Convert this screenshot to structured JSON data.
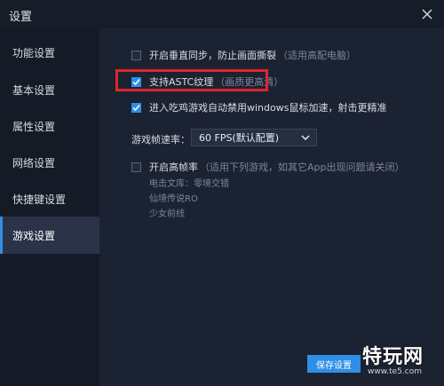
{
  "window": {
    "title": "设置"
  },
  "sidebar": {
    "items": [
      {
        "label": "功能设置",
        "active": false
      },
      {
        "label": "基本设置",
        "active": false
      },
      {
        "label": "属性设置",
        "active": false
      },
      {
        "label": "网络设置",
        "active": false
      },
      {
        "label": "快捷键设置",
        "active": false
      },
      {
        "label": "游戏设置",
        "active": true
      }
    ]
  },
  "options": {
    "vsync": {
      "label": "开启垂直同步，防止画面撕裂",
      "hint": "（适用高配电脑）",
      "checked": false
    },
    "astc": {
      "label": "支持ASTC纹理",
      "hint": "（画质更高清）",
      "checked": true
    },
    "mouse_accel": {
      "label": "进入吃鸡游戏自动禁用windows鼠标加速，射击更精准",
      "checked": true
    },
    "framerate": {
      "label": "游戏帧速率：",
      "value": "60 FPS(默认配置)"
    },
    "high_framerate": {
      "label": "开启高帧率",
      "hint": "（适用下列游戏，如其它App出现问题请关闭）",
      "checked": false,
      "games": [
        "电击文库：零境交错",
        "仙境传说RO",
        "少女前线"
      ]
    }
  },
  "footer": {
    "save_label": "保存设置"
  },
  "watermark": {
    "text": "特玩网",
    "url": "www.te5.com"
  },
  "colors": {
    "accent": "#2e8fe6",
    "highlight": "#e0252b",
    "background": "#1b2232"
  }
}
